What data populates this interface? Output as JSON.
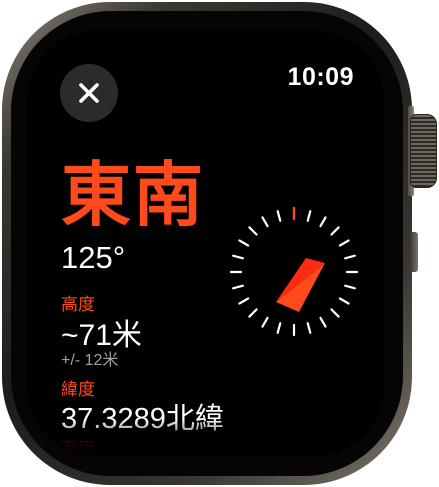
{
  "status": {
    "time": "10:09"
  },
  "controls": {
    "close_icon": "close-icon"
  },
  "heading": {
    "direction": "東南",
    "degrees": "125°",
    "bearing_value": 125
  },
  "altitude": {
    "label": "高度",
    "value": "~71米",
    "accuracy": "+/- 12米"
  },
  "latitude": {
    "label": "緯度",
    "value": "37.3289北緯"
  },
  "next_section": {
    "label": "高度"
  },
  "colors": {
    "accent": "#ff4a1c",
    "background": "#000000",
    "button_bg": "#2b2b2d",
    "secondary_text": "#a0a0a4"
  }
}
